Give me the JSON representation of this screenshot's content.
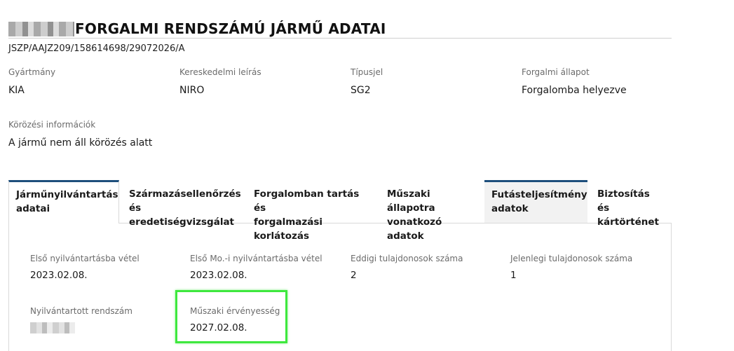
{
  "header": {
    "title": "FORGALMI RENDSZÁMÚ JÁRMŰ ADATAI",
    "document_id": "JSZP/AAJZ209/158614698/29072026/A"
  },
  "vehicle": {
    "manufacturer_label": "Gyártmány",
    "manufacturer_value": "KIA",
    "trade_label": "Kereskedelmi leírás",
    "trade_value": "NIRO",
    "type_label": "Típusjel",
    "type_value": "SG2",
    "traffic_status_label": "Forgalmi állapot",
    "traffic_status_value": "Forgalomba helyezve",
    "wanted_label": "Körözési információk",
    "wanted_value": "A jármű nem áll körözés alatt"
  },
  "tabs": [
    {
      "line1": "Járműnyilvántartás",
      "line2": "adatai"
    },
    {
      "line1": "Származásellenőrzés",
      "line2": "és eredetiségvizsgálat"
    },
    {
      "line1": "Forgalomban tartás és",
      "line2": "forgalmazási korlátozás"
    },
    {
      "line1": "Műszaki állapotra",
      "line2": "vonatkozó adatok"
    },
    {
      "line1": "Futásteljesítmény",
      "line2": "adatok"
    },
    {
      "line1": "Biztosítás és",
      "line2": "kártörténet"
    }
  ],
  "registry": {
    "first_reg_label": "Első nyilvántartásba vétel",
    "first_reg_value": "2023.02.08.",
    "first_hu_reg_label": "Első Mo.-i nyilvántartásba vétel",
    "first_hu_reg_value": "2023.02.08.",
    "prev_owners_label": "Eddigi tulajdonosok száma",
    "prev_owners_value": "2",
    "curr_owners_label": "Jelenlegi tulajdonosok száma",
    "curr_owners_value": "1",
    "plate_label": "Nyilvántartott rendszám",
    "technical_validity_label": "Műszaki érvényesség",
    "technical_validity_value": "2027.02.08."
  },
  "colors": {
    "tab_accent": "#1e4f7c",
    "highlight_border": "#3ee83e"
  }
}
